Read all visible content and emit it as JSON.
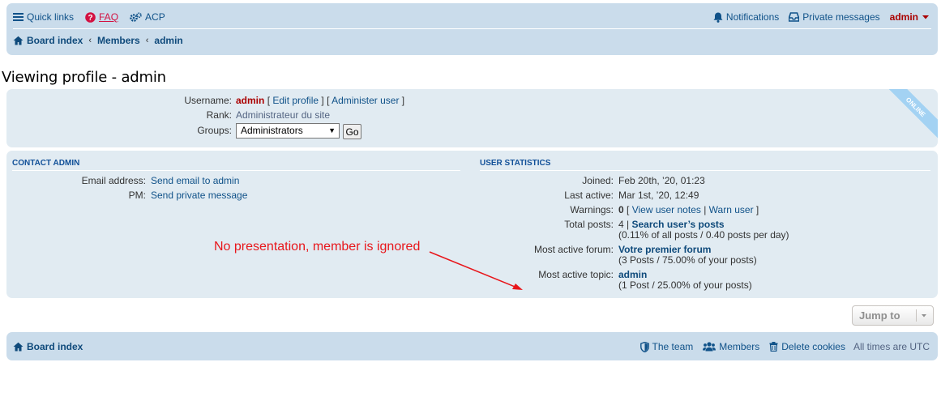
{
  "header": {
    "quick_links": "Quick links",
    "faq": "FAQ",
    "acp": "ACP",
    "notifications": "Notifications",
    "private_messages": "Private messages",
    "user": "admin"
  },
  "breadcrumb": {
    "items": [
      "Board index",
      "Members",
      "admin"
    ]
  },
  "page_title": "Viewing profile - admin",
  "profile": {
    "username_label": "Username:",
    "username": "admin",
    "edit_profile": "Edit profile",
    "administer_user": "Administer user",
    "rank_label": "Rank:",
    "rank": "Administrateur du site",
    "groups_label": "Groups:",
    "group_selected": "Administrators",
    "go_button": "Go",
    "online_badge": "ONLINE"
  },
  "contact": {
    "heading": "CONTACT ADMIN",
    "email_label": "Email address:",
    "email_link": "Send email to admin",
    "pm_label": "PM:",
    "pm_link": "Send private message"
  },
  "stats": {
    "heading": "USER STATISTICS",
    "joined_label": "Joined:",
    "joined": "Feb 20th, ’20, 01:23",
    "last_active_label": "Last active:",
    "last_active": "Mar 1st, ’20, 12:49",
    "warnings_label": "Warnings:",
    "warnings_count": "0",
    "view_user_notes": "View user notes",
    "warn_user": "Warn user",
    "total_posts_label": "Total posts:",
    "total_posts": "4",
    "search_posts": "Search user’s posts",
    "total_posts_detail": "(0.11% of all posts / 0.40 posts per day)",
    "most_active_forum_label": "Most active forum:",
    "most_active_forum": "Votre premier forum",
    "most_active_forum_detail": "(3 Posts / 75.00% of your posts)",
    "most_active_topic_label": "Most active topic:",
    "most_active_topic": "admin",
    "most_active_topic_detail": "(1 Post / 25.00% of your posts)"
  },
  "annotation": {
    "text": "No presentation, member is ignored",
    "color": "#e8161b"
  },
  "jump_to": "Jump to",
  "footer": {
    "board_index": "Board index",
    "the_team": "The team",
    "members": "Members",
    "delete_cookies": "Delete cookies",
    "timezone": "All times are UTC"
  },
  "icons": {
    "quick_links": "bars-icon",
    "faq": "question-circle-icon",
    "acp": "cogs-icon",
    "notifications": "bell-icon",
    "private_messages": "inbox-icon",
    "home": "home-icon",
    "team": "shield-icon",
    "members": "users-icon",
    "delete_cookies": "trash-icon"
  }
}
